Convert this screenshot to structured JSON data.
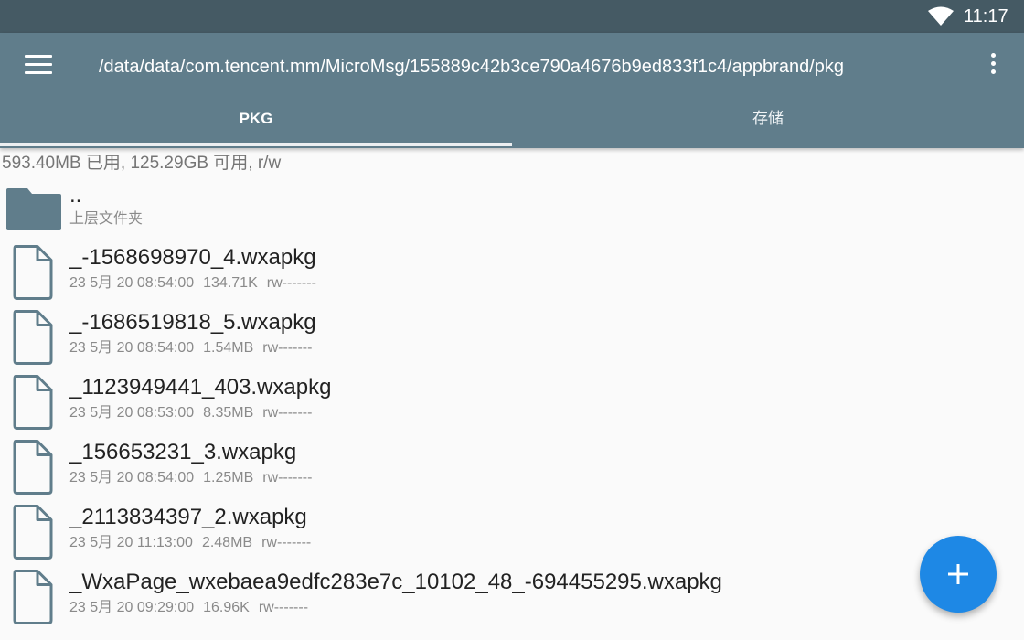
{
  "status_bar": {
    "time": "11:17",
    "wifi_icon": "wifi-icon"
  },
  "app_bar": {
    "menu_icon": "menu-icon",
    "path": "/data/data/com.tencent.mm/MicroMsg/155889c42b3ce790a4676b9ed833f1c4/appbrand/pkg",
    "overflow_icon": "more-vert-icon",
    "tabs": [
      {
        "label": "PKG",
        "selected": true
      },
      {
        "label": "存储",
        "selected": false
      }
    ]
  },
  "storage_info": "593.40MB 已用, 125.29GB 可用, r/w",
  "parent_folder": {
    "name": "..",
    "subtitle": "上层文件夹",
    "icon": "folder-icon"
  },
  "files": [
    {
      "name": "_-1568698970_4.wxapkg",
      "date": "23 5月 20 08:54:00",
      "size": "134.71K",
      "perms": "rw-------"
    },
    {
      "name": "_-1686519818_5.wxapkg",
      "date": "23 5月 20 08:54:00",
      "size": "1.54MB",
      "perms": "rw-------"
    },
    {
      "name": "_1123949441_403.wxapkg",
      "date": "23 5月 20 08:53:00",
      "size": "8.35MB",
      "perms": "rw-------"
    },
    {
      "name": "_156653231_3.wxapkg",
      "date": "23 5月 20 08:54:00",
      "size": "1.25MB",
      "perms": "rw-------"
    },
    {
      "name": "_2113834397_2.wxapkg",
      "date": "23 5月 20 11:13:00",
      "size": "2.48MB",
      "perms": "rw-------"
    },
    {
      "name": "_WxaPage_wxebaea9edfc283e7c_10102_48_-694455295.wxapkg",
      "date": "23 5月 20 09:29:00",
      "size": "16.96K",
      "perms": "rw-------"
    }
  ],
  "fab": {
    "icon": "plus-icon"
  },
  "colors": {
    "status_bar": "#455a64",
    "app_bar": "#607d8b",
    "folder": "#607d8b",
    "fab": "#1e88e5",
    "background": "#fafafa"
  }
}
